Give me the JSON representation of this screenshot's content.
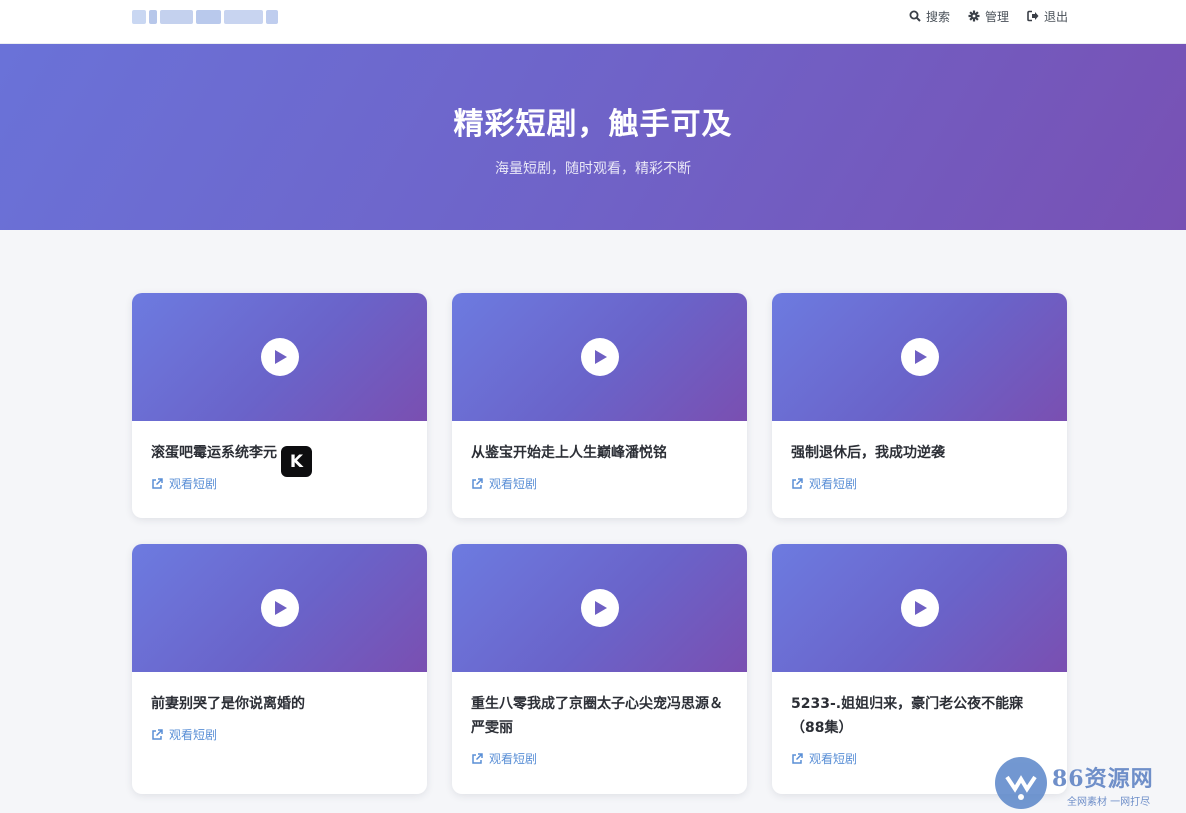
{
  "nav": {
    "links": [
      {
        "label": "搜索",
        "icon": "search-icon"
      },
      {
        "label": "管理",
        "icon": "gear-icon"
      },
      {
        "label": "退出",
        "icon": "logout-icon"
      }
    ]
  },
  "hero": {
    "title": "精彩短剧，触手可及",
    "subtitle": "海量短剧，随时观看，精彩不断"
  },
  "cards": [
    {
      "title": "滚蛋吧霉运系统李元",
      "link": "观看短剧"
    },
    {
      "title": "从鉴宝开始走上人生巅峰潘悦铭",
      "link": "观看短剧"
    },
    {
      "title": "强制退休后，我成功逆袭",
      "link": "观看短剧"
    },
    {
      "title": "前妻别哭了是你说离婚的",
      "link": "观看短剧"
    },
    {
      "title": "重生八零我成了京圈太子心尖宠冯思源＆严雯丽",
      "link": "观看短剧"
    },
    {
      "title": "5233-.姐姐归来，豪门老公夜不能寐（88集）",
      "link": "观看短剧"
    }
  ],
  "watermark": {
    "name": "86资源网",
    "tagline": "全网素材 一网打尽"
  },
  "colors": {
    "accent": "#6f63c8",
    "link": "#5a8fd6"
  }
}
